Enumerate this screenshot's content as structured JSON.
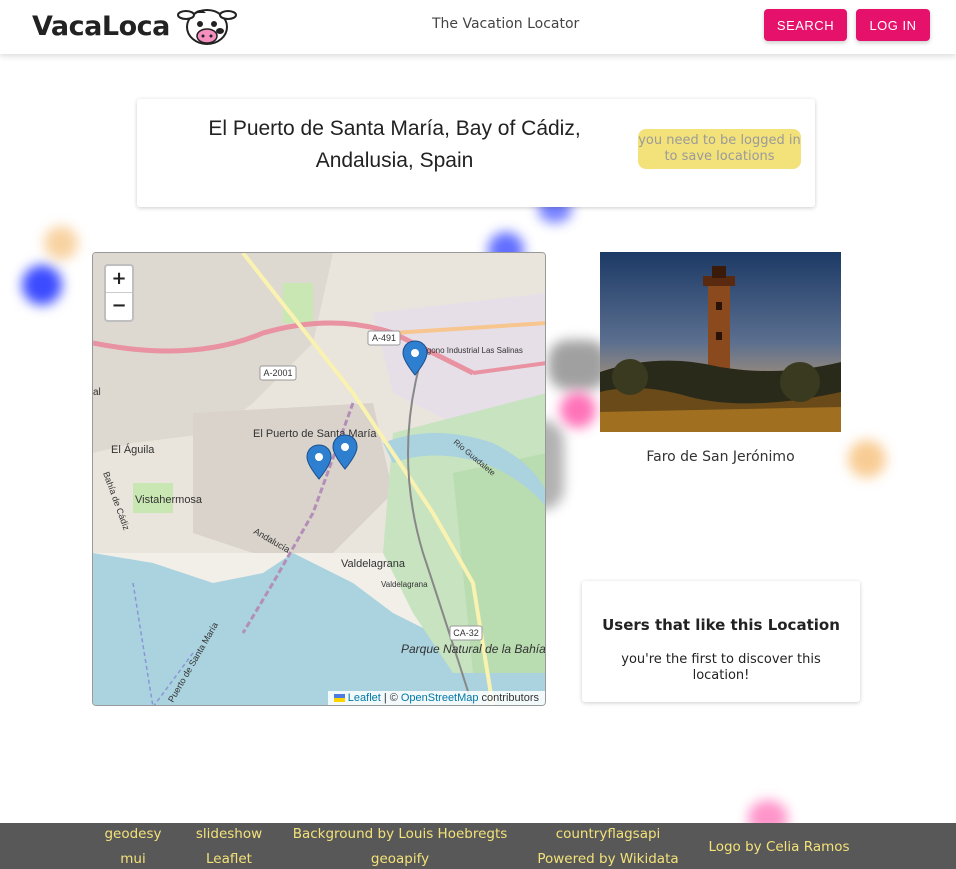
{
  "header": {
    "logo_text": "VacaLoca",
    "tagline": "The Vacation Locator",
    "search_label": "SEARCH",
    "login_label": "LOG IN"
  },
  "location": {
    "title": "El Puerto de Santa María, Bay of Cádiz, Andalusia, Spain",
    "save_notice": "you need to be logged in to save locations"
  },
  "map": {
    "zoom_in": "+",
    "zoom_out": "−",
    "attribution_leaflet": "Leaflet",
    "attribution_sep": "| ©",
    "attribution_osm": "OpenStreetMap",
    "attribution_contrib": "contributors",
    "labels": {
      "a491": "A-491",
      "a2001": "A-2001",
      "ca32": "CA-32",
      "city": "El Puerto de Santa María",
      "el_aguila": "El Águila",
      "vistahermosa": "Vistahermosa",
      "poligono": "Polígono Industrial Las Salinas",
      "valdelagrana": "Valdelagrana",
      "valdelagrana2": "Valdelagrana",
      "parque": "Parque Natural de la Bahía",
      "bahia_cadiz": "Bahía de Cádiz",
      "rio": "Río Guadalete",
      "andalucia": "Andalucía",
      "puerto": "Puerto de Santa María",
      "al": "al"
    },
    "marker_icon": "map-marker-icon"
  },
  "photo": {
    "caption": "Faro de San Jerónimo"
  },
  "users": {
    "title": "Users that like this Location",
    "text": "you're the first to discover this location!"
  },
  "footer": {
    "links": {
      "geodesy": "geodesy",
      "mui": "mui",
      "slideshow": "slideshow",
      "leaflet": "Leaflet",
      "background": "Background by Louis Hoebregts",
      "geoapify": "geoapify",
      "countryflags": "countryflagsapi",
      "wikidata": "Powered by Wikidata",
      "logo_by": "Logo by Celia Ramos"
    }
  },
  "colors": {
    "accent": "#e5116b",
    "footer_bg": "#585858",
    "footer_link": "#f3e27a",
    "save_pill": "#f3e27a"
  }
}
